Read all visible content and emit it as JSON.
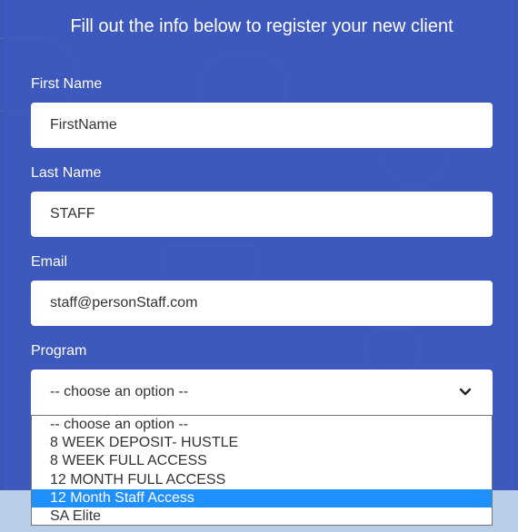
{
  "form": {
    "title": "Fill out the info below to register your new client",
    "first_name": {
      "label": "First Name",
      "value": "FirstName"
    },
    "last_name": {
      "label": "Last Name",
      "value": "STAFF"
    },
    "email": {
      "label": "Email",
      "value": "staff@personStaff.com"
    },
    "program": {
      "label": "Program",
      "selected": "-- choose an option --",
      "options": [
        "-- choose an option --",
        "8 WEEK DEPOSIT- HUSTLE",
        "8 WEEK FULL ACCESS",
        "12 MONTH FULL ACCESS",
        "12 Month Staff Access",
        "SA Elite"
      ],
      "highlighted_option": "12 Month Staff Access"
    }
  },
  "icons": {
    "dropdown_chevron": "chevron-down-icon"
  },
  "colors": {
    "background": "#3b57b5",
    "highlight": "#1e90ff",
    "text_light": "#ffffff"
  }
}
